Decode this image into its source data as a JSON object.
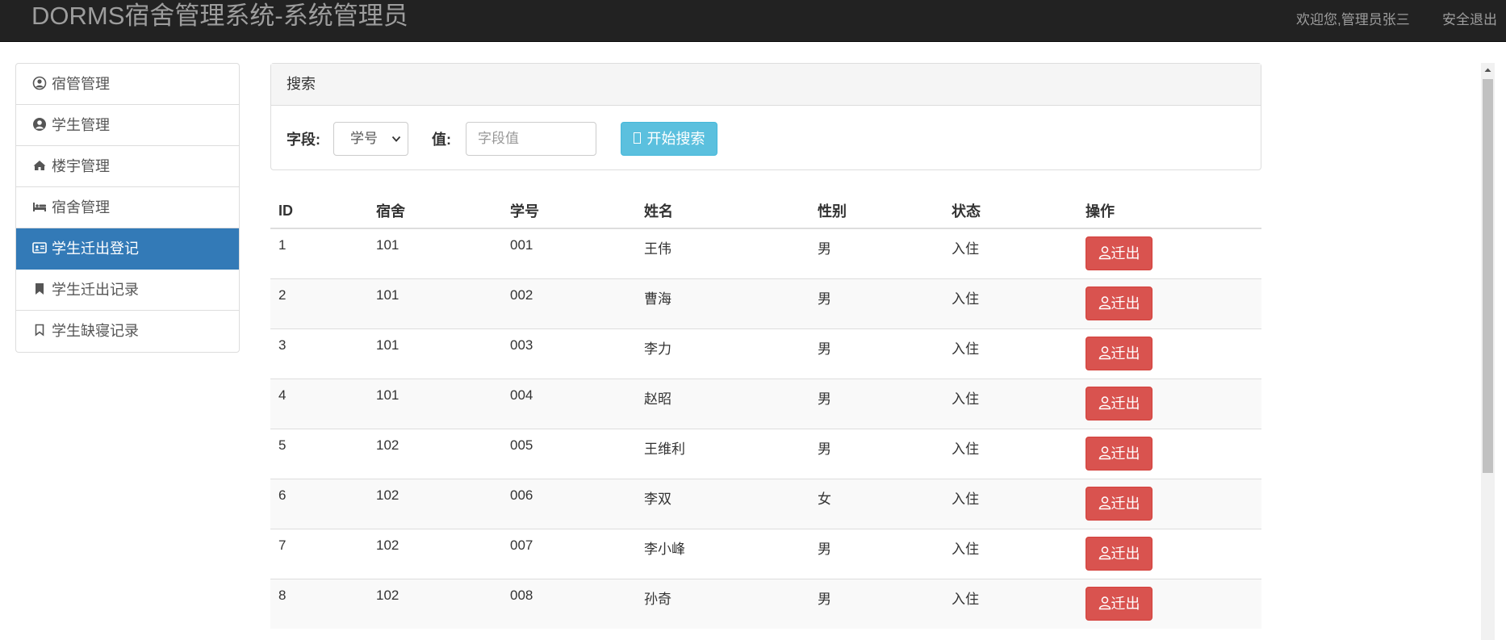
{
  "navbar": {
    "brand": "DORMS宿舍管理系统-系统管理员",
    "welcome": "欢迎您,管理员张三",
    "logout": "安全退出"
  },
  "sidebar": {
    "items": [
      {
        "label": "宿管管理",
        "icon": "user-circle-icon",
        "active": false
      },
      {
        "label": "学生管理",
        "icon": "user-circle-filled-icon",
        "active": false
      },
      {
        "label": "楼宇管理",
        "icon": "home-icon",
        "active": false
      },
      {
        "label": "宿舍管理",
        "icon": "bed-icon",
        "active": false
      },
      {
        "label": "学生迁出登记",
        "icon": "id-card-icon",
        "active": true
      },
      {
        "label": "学生迁出记录",
        "icon": "bookmark-filled-icon",
        "active": false
      },
      {
        "label": "学生缺寝记录",
        "icon": "bookmark-outline-icon",
        "active": false
      }
    ]
  },
  "search": {
    "heading": "搜索",
    "field_label": "字段:",
    "field_selected": "学号",
    "value_label": "值:",
    "value_placeholder": "字段值",
    "button_label": "开始搜索"
  },
  "table": {
    "headers": [
      "ID",
      "宿舍",
      "学号",
      "姓名",
      "性别",
      "状态",
      "操作"
    ],
    "rows": [
      {
        "id": "1",
        "dorm": "101",
        "sno": "001",
        "name": "王伟",
        "sex": "男",
        "state": "入住",
        "action": "迁出"
      },
      {
        "id": "2",
        "dorm": "101",
        "sno": "002",
        "name": "曹海",
        "sex": "男",
        "state": "入住",
        "action": "迁出"
      },
      {
        "id": "3",
        "dorm": "101",
        "sno": "003",
        "name": "李力",
        "sex": "男",
        "state": "入住",
        "action": "迁出"
      },
      {
        "id": "4",
        "dorm": "101",
        "sno": "004",
        "name": "赵昭",
        "sex": "男",
        "state": "入住",
        "action": "迁出"
      },
      {
        "id": "5",
        "dorm": "102",
        "sno": "005",
        "name": "王维利",
        "sex": "男",
        "state": "入住",
        "action": "迁出"
      },
      {
        "id": "6",
        "dorm": "102",
        "sno": "006",
        "name": "李双",
        "sex": "女",
        "state": "入住",
        "action": "迁出"
      },
      {
        "id": "7",
        "dorm": "102",
        "sno": "007",
        "name": "李小峰",
        "sex": "男",
        "state": "入住",
        "action": "迁出"
      },
      {
        "id": "8",
        "dorm": "102",
        "sno": "008",
        "name": "孙奇",
        "sex": "男",
        "state": "入住",
        "action": "迁出"
      }
    ]
  },
  "colors": {
    "navbar_bg": "#222222",
    "active_item": "#337ab7",
    "search_button": "#5bc0de",
    "danger_button": "#d9534f"
  }
}
